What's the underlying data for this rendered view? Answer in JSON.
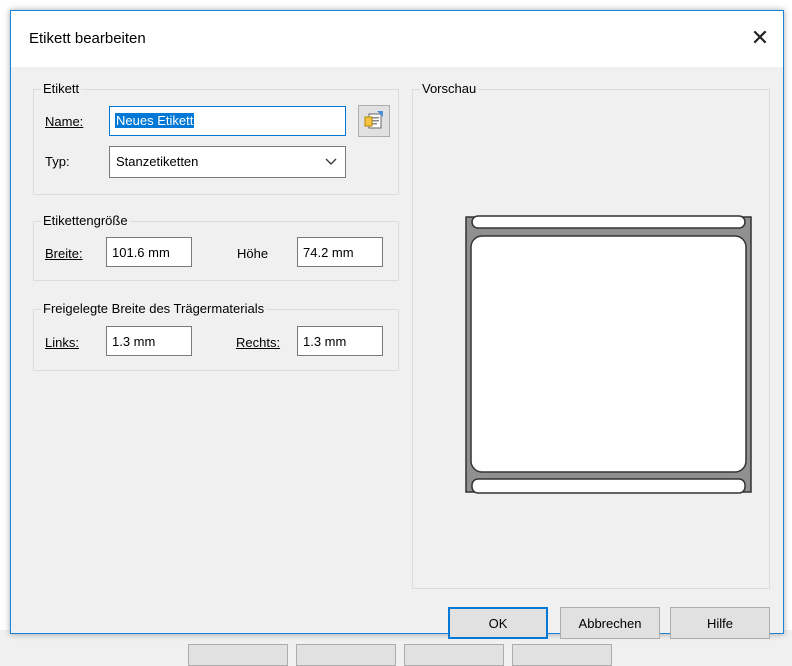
{
  "dialog": {
    "title": "Etikett bearbeiten",
    "close_label": "✕"
  },
  "etikett_group": {
    "legend": "Etikett",
    "name_label": "Name:",
    "name_value": "Neues Etikett",
    "typ_label": "Typ:",
    "typ_value": "Stanzetiketten"
  },
  "size_group": {
    "legend": "Etikettengröße",
    "breite_label": "Breite:",
    "breite_value": "101.6 mm",
    "hoehe_label": "Höhe",
    "hoehe_value": "74.2 mm"
  },
  "liner_group": {
    "legend": "Freigelegte Breite des Trägermaterials",
    "links_label": "Links:",
    "links_value": "1.3 mm",
    "rechts_label": "Rechts:",
    "rechts_value": "1.3 mm"
  },
  "preview": {
    "legend": "Vorschau"
  },
  "buttons": {
    "ok": "OK",
    "cancel": "Abbrechen",
    "help": "Hilfe"
  },
  "icons": {
    "label_properties": "label-properties-icon",
    "dropdown": "chevron-down-icon",
    "close": "close-icon"
  },
  "colors": {
    "accent": "#0078d7",
    "dialog_bg": "#f0f0f0"
  }
}
